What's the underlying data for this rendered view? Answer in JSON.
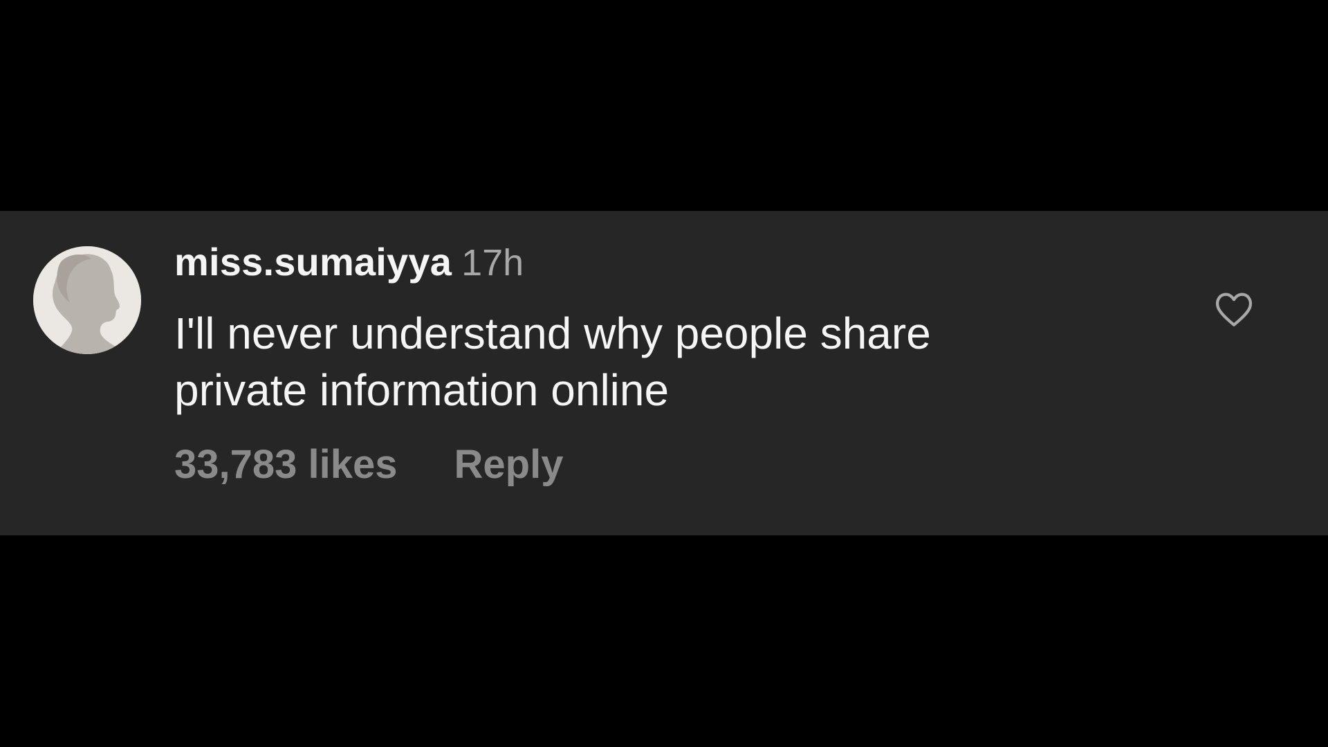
{
  "comment": {
    "username": "miss.sumaiyya",
    "time_ago": "17h",
    "text_lines": [
      "I'll never understand why people share",
      "private information online"
    ],
    "likes_label": "33,783 likes",
    "reply_label": "Reply",
    "avatar": "woman-silhouette-avatar",
    "like_icon": "heart-outline-icon"
  },
  "colors": {
    "background": "#000000",
    "card": "#262626",
    "primary_text": "#f5f5f5",
    "secondary_text": "#a8a8a8",
    "action_text": "#8a8a8a"
  }
}
